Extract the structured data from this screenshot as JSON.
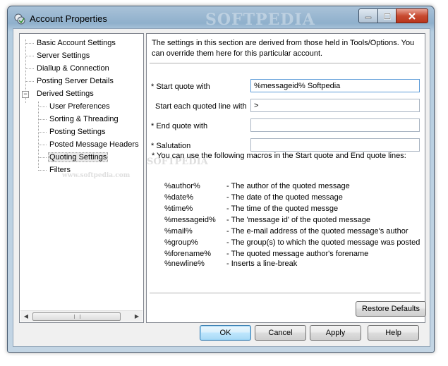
{
  "window": {
    "title": "Account Properties",
    "watermark": "SOFTPEDIA"
  },
  "tree": {
    "items": [
      {
        "label": "Basic Account Settings"
      },
      {
        "label": "Server Settings"
      },
      {
        "label": "Diallup & Connection"
      },
      {
        "label": "Posting Server Details"
      },
      {
        "label": "Derived Settings",
        "expanded": true
      },
      {
        "label": "User Preferences"
      },
      {
        "label": "Sorting & Threading"
      },
      {
        "label": "Posting Settings"
      },
      {
        "label": "Posted Message Headers"
      },
      {
        "label": "Quoting Settings",
        "selected": true
      },
      {
        "label": "Filters"
      }
    ],
    "watermark": "www.softpedia.com"
  },
  "panel": {
    "intro": "The settings in this section are derived from those held in Tools/Options.  You can override them here for this particular account.",
    "fields": [
      {
        "label": "* Start quote with",
        "value": "%messageid% Softpedia"
      },
      {
        "label": "Start each quoted line with",
        "value": ">"
      },
      {
        "label": "* End quote with",
        "value": ""
      },
      {
        "label": "* Salutation",
        "value": ""
      }
    ],
    "macro_note": "* You can use the following macros in the Start quote and End quote lines:",
    "macros": [
      {
        "name": "%author%",
        "desc": "- The author of the quoted message"
      },
      {
        "name": "%date%",
        "desc": "- The date of the quoted message"
      },
      {
        "name": "%time%",
        "desc": "- The time of the quoted messge"
      },
      {
        "name": "%messageid%",
        "desc": "- The 'message id' of the quoted message"
      },
      {
        "name": "%mail%",
        "desc": "- The e-mail address of the quoted message's author"
      },
      {
        "name": "%group%",
        "desc": "- The group(s) to which the quoted message was posted"
      },
      {
        "name": "%forename%",
        "desc": "- The quoted message author's forename"
      },
      {
        "name": "%newline%",
        "desc": "- Inserts a line-break"
      }
    ],
    "restore_label": "Restore Defaults"
  },
  "buttons": {
    "ok": "OK",
    "cancel": "Cancel",
    "apply": "Apply",
    "help": "Help"
  },
  "colors": {
    "titlebar": "#8fb0cc",
    "close": "#c84b31",
    "default_button": "#bee6fd"
  }
}
